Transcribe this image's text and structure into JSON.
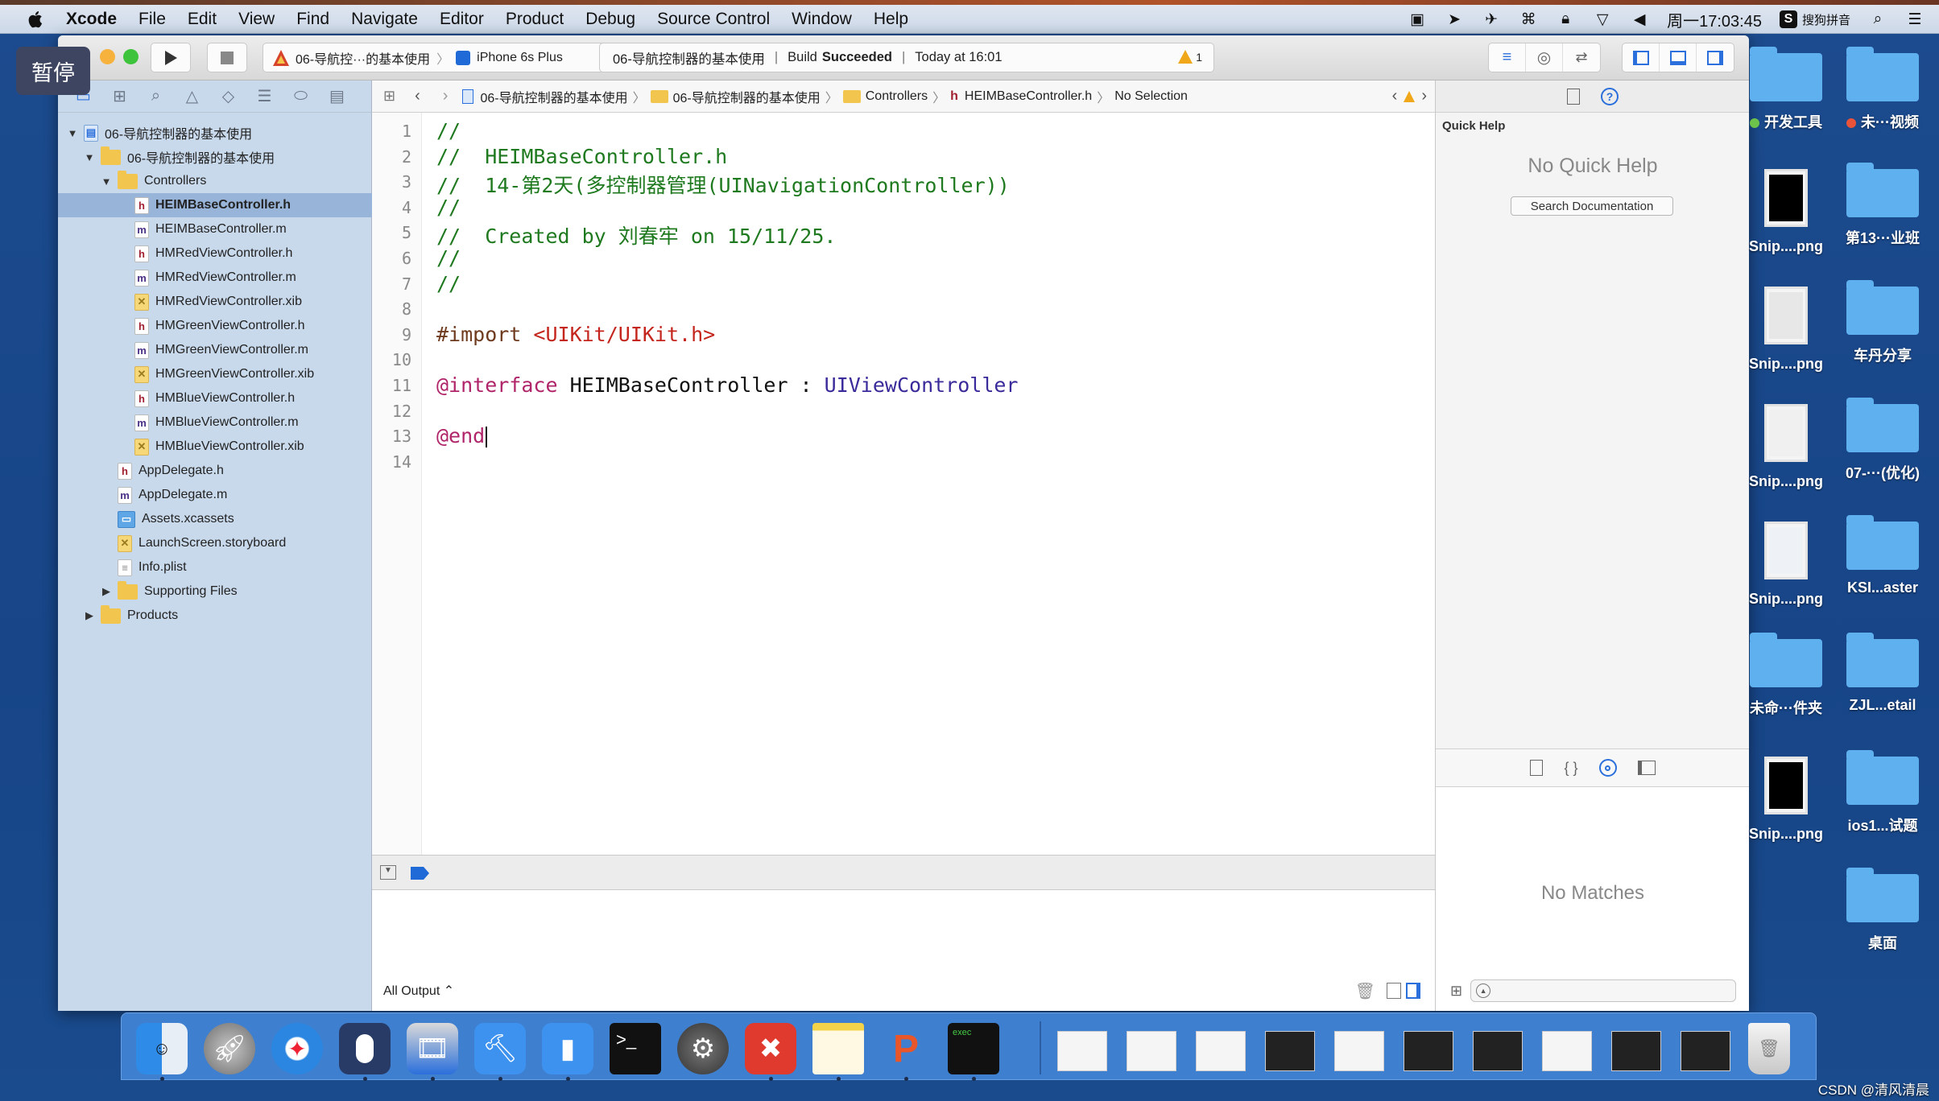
{
  "overlay": {
    "pause_label": "暂停"
  },
  "menubar": {
    "app": "Xcode",
    "items": [
      "File",
      "Edit",
      "View",
      "Find",
      "Navigate",
      "Editor",
      "Product",
      "Debug",
      "Source Control",
      "Window",
      "Help"
    ],
    "clock": "周一17:03:45",
    "ime_label": "搜狗拼音",
    "ime_icon": "S",
    "status_icons": [
      "screen-record-icon",
      "location-icon",
      "airplane-icon",
      "network-icon",
      "lock-icon",
      "wifi-icon",
      "volume-icon",
      "spotlight-icon",
      "notification-center-icon"
    ]
  },
  "toolbar": {
    "scheme": "06-导航控···的基本使用",
    "device": "iPhone 6s Plus",
    "activity": {
      "project": "06-导航控制器的基本使用",
      "build_prefix": "Build",
      "build_status": "Succeeded",
      "time": "Today at 16:01",
      "warning_count": "1"
    }
  },
  "navigator": {
    "tree": [
      {
        "label": "06-导航控制器的基本使用",
        "type": "proj",
        "depth": 0,
        "disclosure": "open"
      },
      {
        "label": "06-导航控制器的基本使用",
        "type": "folder",
        "depth": 1,
        "disclosure": "open"
      },
      {
        "label": "Controllers",
        "type": "folder",
        "depth": 2,
        "disclosure": "open"
      },
      {
        "label": "HEIMBaseController.h",
        "type": "h",
        "depth": 3,
        "selected": true
      },
      {
        "label": "HEIMBaseController.m",
        "type": "m",
        "depth": 3
      },
      {
        "label": "HMRedViewController.h",
        "type": "h",
        "depth": 3
      },
      {
        "label": "HMRedViewController.m",
        "type": "m",
        "depth": 3
      },
      {
        "label": "HMRedViewController.xib",
        "type": "xib",
        "depth": 3
      },
      {
        "label": "HMGreenViewController.h",
        "type": "h",
        "depth": 3
      },
      {
        "label": "HMGreenViewController.m",
        "type": "m",
        "depth": 3
      },
      {
        "label": "HMGreenViewController.xib",
        "type": "xib",
        "depth": 3
      },
      {
        "label": "HMBlueViewController.h",
        "type": "h",
        "depth": 3
      },
      {
        "label": "HMBlueViewController.m",
        "type": "m",
        "depth": 3
      },
      {
        "label": "HMBlueViewController.xib",
        "type": "xib",
        "depth": 3
      },
      {
        "label": "AppDelegate.h",
        "type": "h",
        "depth": 2
      },
      {
        "label": "AppDelegate.m",
        "type": "m",
        "depth": 2
      },
      {
        "label": "Assets.xcassets",
        "type": "assets",
        "depth": 2
      },
      {
        "label": "LaunchScreen.storyboard",
        "type": "xib",
        "depth": 2
      },
      {
        "label": "Info.plist",
        "type": "plist",
        "depth": 2
      },
      {
        "label": "Supporting Files",
        "type": "folder",
        "depth": 2,
        "disclosure": "closed"
      },
      {
        "label": "Products",
        "type": "folder",
        "depth": 1,
        "disclosure": "closed"
      }
    ]
  },
  "jumpbar": {
    "crumbs": [
      "06-导航控制器的基本使用",
      "06-导航控制器的基本使用",
      "Controllers",
      "HEIMBaseController.h",
      "No Selection"
    ]
  },
  "editor": {
    "lines": [
      [
        {
          "t": "//",
          "c": "comment"
        }
      ],
      [
        {
          "t": "//  HEIMBaseController.h",
          "c": "comment"
        }
      ],
      [
        {
          "t": "//  14-第2天(多控制器管理(UINavigationController))",
          "c": "comment"
        }
      ],
      [
        {
          "t": "//",
          "c": "comment"
        }
      ],
      [
        {
          "t": "//  Created by 刘春牢 on 15/11/25.",
          "c": "comment"
        }
      ],
      [
        {
          "t": "//",
          "c": "comment"
        }
      ],
      [
        {
          "t": "//",
          "c": "comment"
        }
      ],
      [],
      [
        {
          "t": "#import ",
          "c": "pre"
        },
        {
          "t": "<UIKit/UIKit.h>",
          "c": "str"
        }
      ],
      [],
      [
        {
          "t": "@interface",
          "c": "kw"
        },
        {
          "t": " HEIMBaseController : ",
          "c": "plain"
        },
        {
          "t": "UIViewController",
          "c": "type"
        }
      ],
      [],
      [
        {
          "t": "@end",
          "c": "kw"
        }
      ],
      []
    ],
    "caret_line": 13
  },
  "console": {
    "output_filter": "All Output ⌃"
  },
  "inspector": {
    "quick_help_title": "Quick Help",
    "quick_help_empty": "No Quick Help",
    "search_docs_button": "Search Documentation",
    "library_empty": "No Matches"
  },
  "desktop": {
    "items": [
      {
        "label": "开发工具",
        "kind": "folder",
        "tag": "#6cc24a"
      },
      {
        "label": "未···视频",
        "kind": "folder",
        "tag": "#e8533a"
      },
      {
        "label": "Snip....png",
        "kind": "thumb",
        "thumb": "#000000"
      },
      {
        "label": "第13···业班",
        "kind": "folder"
      },
      {
        "label": "Snip....png",
        "kind": "thumb",
        "thumb": "#e7e7e7"
      },
      {
        "label": "车丹分享",
        "kind": "folder"
      },
      {
        "label": "Snip....png",
        "kind": "thumb",
        "thumb": "#f0f0f0"
      },
      {
        "label": "07-···(优化)",
        "kind": "folder"
      },
      {
        "label": "Snip....png",
        "kind": "thumb",
        "thumb": "#eef2f6"
      },
      {
        "label": "KSI...aster",
        "kind": "folder"
      },
      {
        "label": "未命···件夹",
        "kind": "folder"
      },
      {
        "label": "ZJL...etail",
        "kind": "folder"
      },
      {
        "label": "Snip....png",
        "kind": "thumb",
        "thumb": "#000000"
      },
      {
        "label": "ios1...试题",
        "kind": "folder"
      },
      {
        "label": "桌面",
        "kind": "folder"
      }
    ]
  },
  "dock": {
    "apps": [
      "Finder",
      "Launchpad",
      "Safari",
      "Mouse",
      "Video Editor",
      "Xcode",
      "Simulator",
      "Terminal",
      "System Preferences",
      "XMind",
      "Notes",
      "Presentation",
      "Exec Terminal"
    ],
    "watermark": "CSDN @清风清晨"
  }
}
